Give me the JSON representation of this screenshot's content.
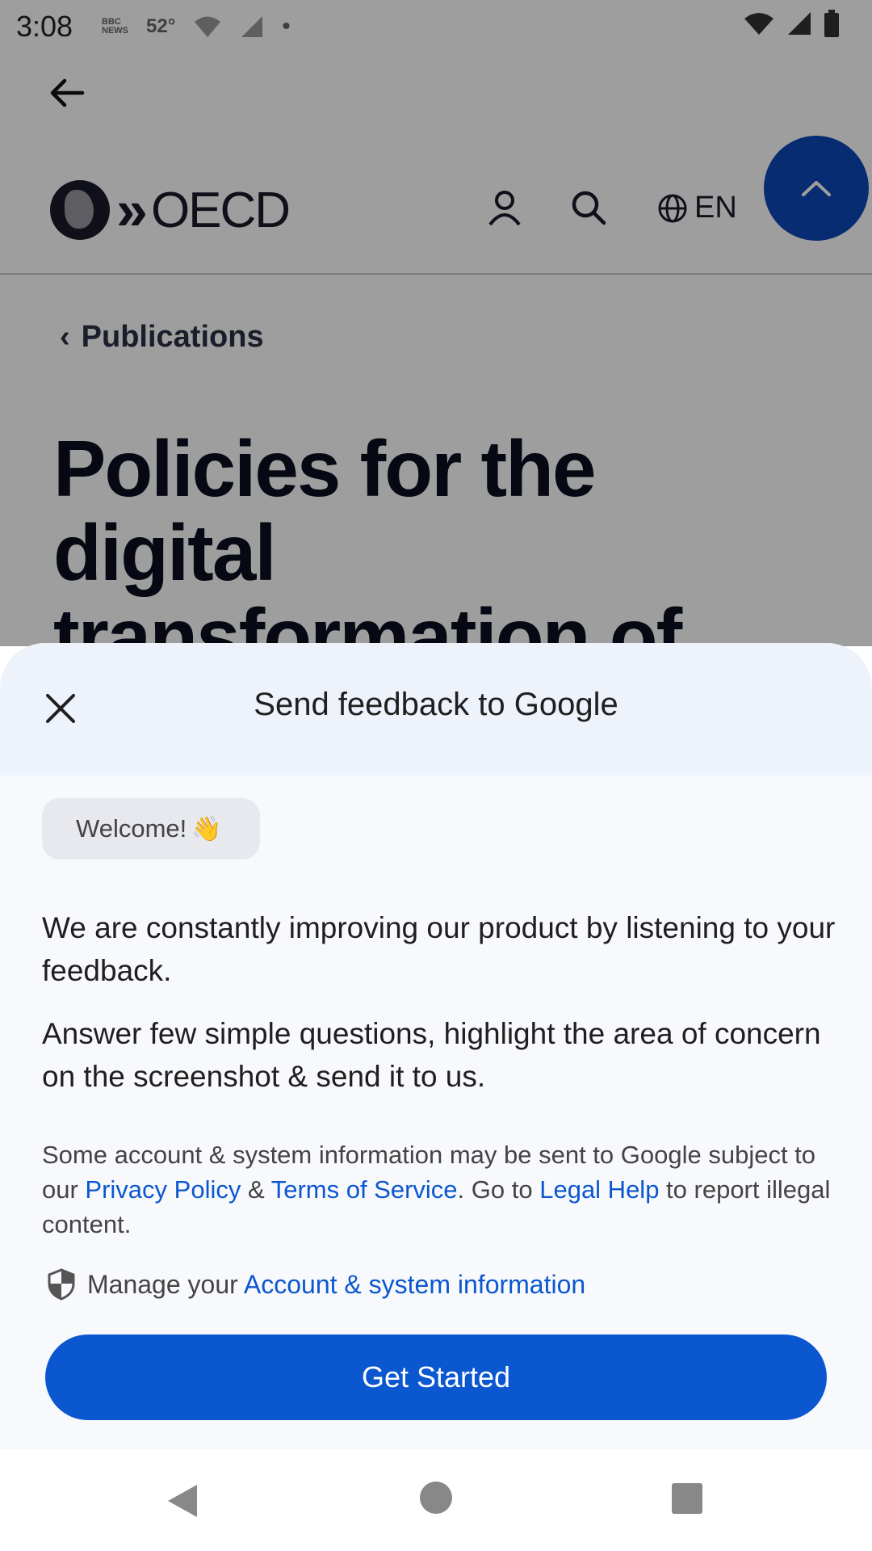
{
  "status_bar": {
    "time": "3:08",
    "left_icons": [
      "BBC NEWS",
      "52°",
      "wifi-question-icon",
      "signal-question-icon",
      "•"
    ],
    "right_icons": [
      "wifi-icon",
      "signal-icon",
      "battery-icon"
    ]
  },
  "background_page": {
    "logo_text": "OECD",
    "language_label": "EN",
    "breadcrumb_label": "Publications",
    "title_lines": [
      "Policies for the",
      "digital",
      "transformation of"
    ],
    "scroll_top_color": "#0d47b8"
  },
  "sheet": {
    "title": "Send feedback to Google",
    "welcome_chip": "Welcome!",
    "welcome_emoji": "👋",
    "intro_text": "We are constantly improving our product by listening to your feedback.",
    "answer_text": "Answer few simple questions, highlight the area of concern on the screenshot & send it to us.",
    "legal": {
      "prefix": "Some account & system information may be sent to Google subject to our ",
      "privacy_link": "Privacy Policy",
      "amp": " & ",
      "terms_link": "Terms of Service",
      "mid": ". Go to ",
      "legal_help_link": "Legal Help",
      "suffix": " to report illegal content."
    },
    "manage": {
      "prefix": "Manage your ",
      "link": "Account & system information"
    },
    "cta_label": "Get Started",
    "accent_color": "#0b57d0"
  }
}
